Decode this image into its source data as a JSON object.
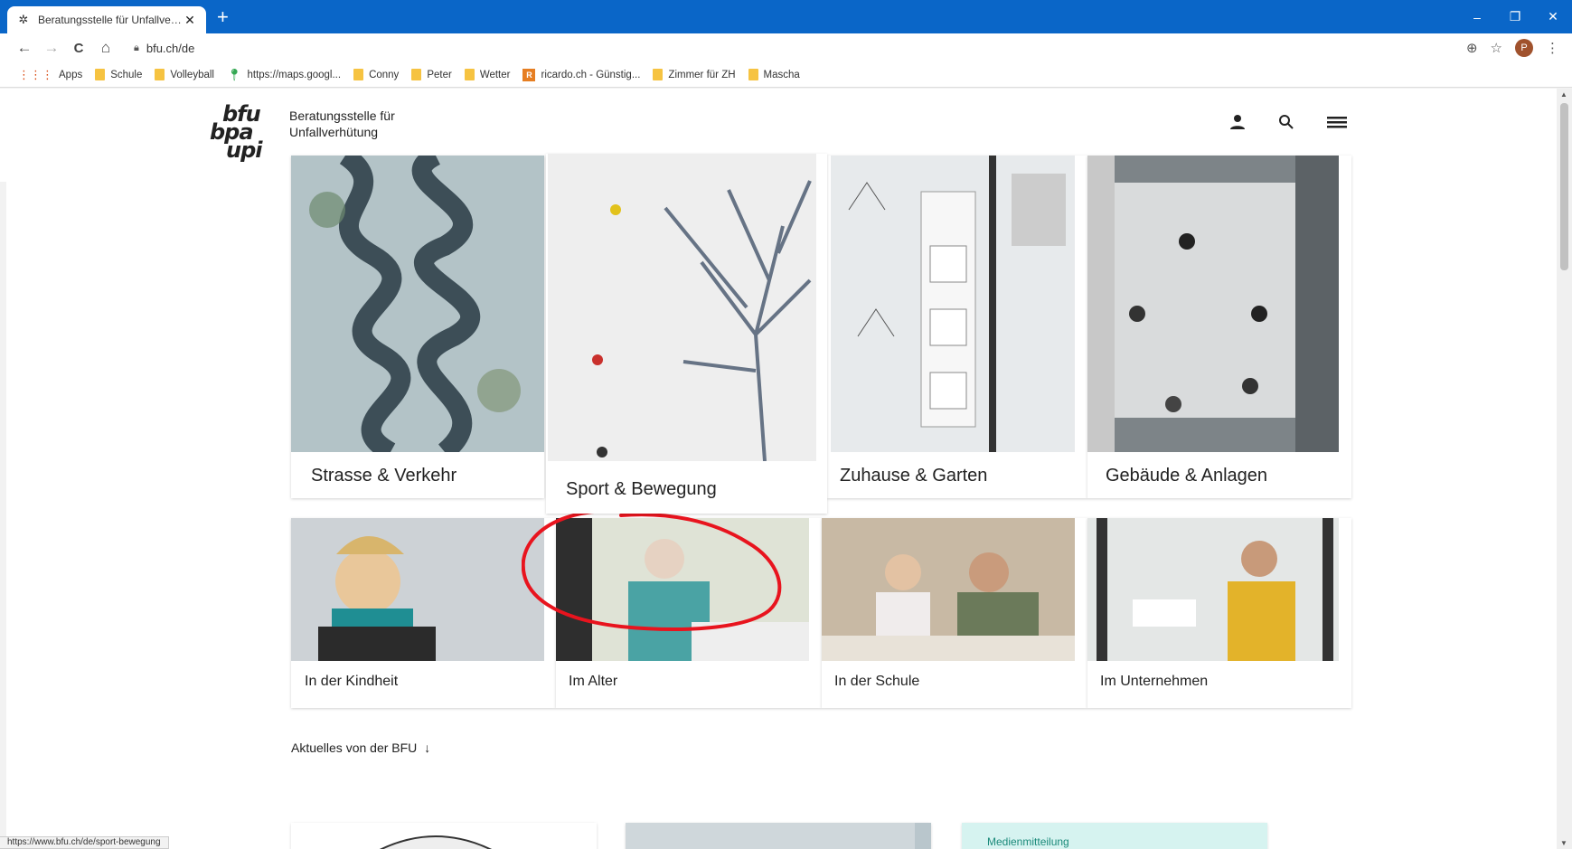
{
  "tab": {
    "title": "Beratungsstelle für Unfallverhüt…",
    "close": "✕"
  },
  "newtab": "+",
  "window": {
    "minimize": "–",
    "restore": "❐",
    "close": "✕"
  },
  "nav": {
    "back": "←",
    "forward": "→",
    "reload": "C",
    "home": "⌂"
  },
  "url": "bfu.ch/de",
  "toolbar_icons": {
    "zoom": "⊕",
    "star": "☆",
    "profile": "P",
    "menu": "⋮"
  },
  "bookmarks": [
    {
      "label": "Apps",
      "type": "apps"
    },
    {
      "label": "Schule",
      "type": "folder"
    },
    {
      "label": "Volleyball",
      "type": "folder"
    },
    {
      "label": "https://maps.googl...",
      "type": "maps"
    },
    {
      "label": "Conny",
      "type": "folder"
    },
    {
      "label": "Peter",
      "type": "folder"
    },
    {
      "label": "Wetter",
      "type": "folder"
    },
    {
      "label": "ricardo.ch - Günstig...",
      "type": "ricardo"
    },
    {
      "label": "Zimmer für ZH",
      "type": "folder"
    },
    {
      "label": "Mascha",
      "type": "folder"
    }
  ],
  "site": {
    "logo_lines": [
      "bfu",
      "bpa",
      "upi"
    ],
    "brand_line1": "Beratungsstelle für",
    "brand_line2": "Unfallverhütung"
  },
  "topics": [
    {
      "label": "Strasse & Verkehr"
    },
    {
      "label": "Sport & Bewegung"
    },
    {
      "label": "Zuhause & Garten"
    },
    {
      "label": "Gebäude & Anlagen"
    }
  ],
  "groups": [
    {
      "label": "In der Kindheit"
    },
    {
      "label": "Im Alter"
    },
    {
      "label": "In der Schule"
    },
    {
      "label": "Im Unternehmen"
    }
  ],
  "news_section": {
    "title": "Aktuelles von der BFU",
    "arrow": "↓"
  },
  "news_tag": "Medienmitteilung",
  "statusbar": "https://www.bfu.ch/de/sport-bewegung",
  "colors": {
    "chrome_blue": "#0a66c8",
    "annotation_red": "#e8141e",
    "teal": "#d6f3f0"
  }
}
